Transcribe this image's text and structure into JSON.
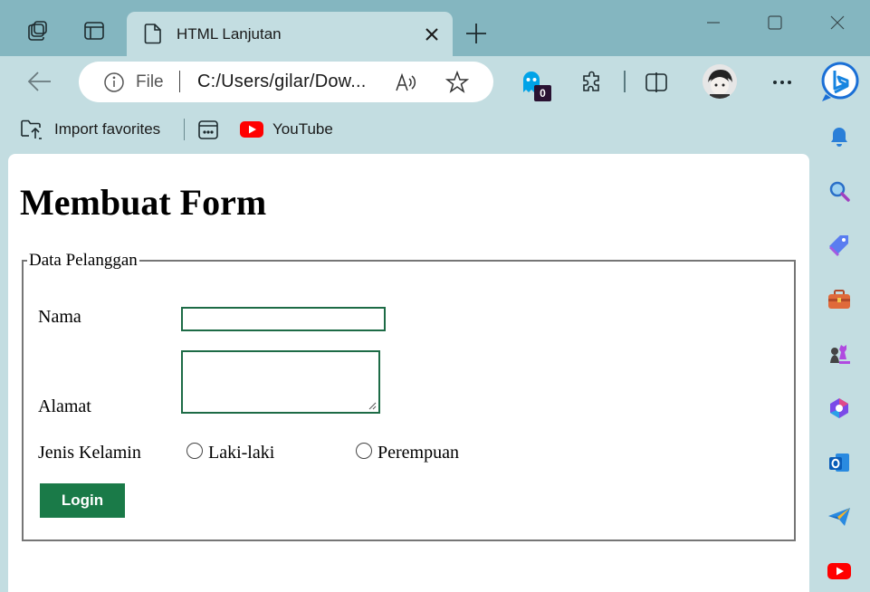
{
  "tab": {
    "title": "HTML Lanjutan"
  },
  "address": {
    "scheme_label": "File",
    "url": "C:/Users/gilar/Dow..."
  },
  "extension": {
    "badge": "0"
  },
  "favorites": {
    "import_label": "Import favorites",
    "youtube_label": "YouTube"
  },
  "page": {
    "heading": "Membuat Form",
    "legend": "Data Pelanggan",
    "nama_label": "Nama",
    "alamat_label": "Alamat",
    "gender_label": "Jenis Kelamin",
    "options": [
      "Laki-laki",
      "Perempuan"
    ],
    "login_label": "Login"
  },
  "colors": {
    "titlebar": "#84b6c0",
    "chrome": "#c3dde1",
    "button": "#1a7a48",
    "input_border": "#1d6b46"
  },
  "icons": [
    "workspaces-icon",
    "tab-actions-icon",
    "page-icon",
    "close-icon",
    "plus-icon",
    "minimize-icon",
    "maximize-icon",
    "back-icon",
    "info-icon",
    "read-aloud-icon",
    "star-icon",
    "ghost-icon",
    "extensions-icon",
    "split-screen-icon",
    "more-icon",
    "copilot-icon",
    "bell-icon",
    "search-icon",
    "tag-icon",
    "briefcase-icon",
    "chess-icon",
    "office-icon",
    "outlook-icon",
    "send-icon",
    "youtube-icon"
  ]
}
